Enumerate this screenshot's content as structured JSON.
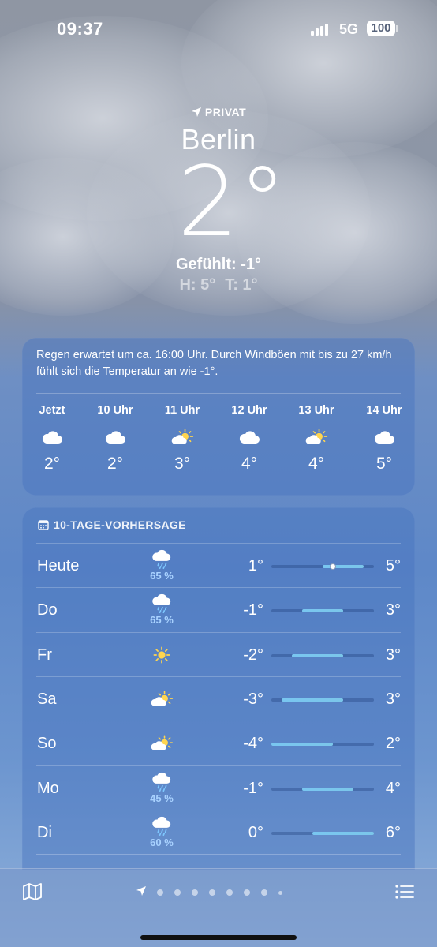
{
  "status_bar": {
    "time": "09:37",
    "network": "5G",
    "battery": "100"
  },
  "header": {
    "location_tag": "PRIVAT",
    "city": "Berlin",
    "temperature": "2°",
    "feels_like": "Gefühlt: -1°",
    "high": "H: 5°",
    "low": "T: 1°"
  },
  "hourly": {
    "summary": "Regen erwartet um ca. 16:00 Uhr. Durch Windböen mit bis zu 27 km/h fühlt sich die Temperatur an wie -1°.",
    "hours": [
      {
        "label": "Jetzt",
        "icon": "cloud-icon",
        "temp": "2°"
      },
      {
        "label": "10 Uhr",
        "icon": "cloud-icon",
        "temp": "2°"
      },
      {
        "label": "11 Uhr",
        "icon": "partly-sunny-icon",
        "temp": "3°"
      },
      {
        "label": "12 Uhr",
        "icon": "cloud-icon",
        "temp": "4°"
      },
      {
        "label": "13 Uhr",
        "icon": "partly-sunny-icon",
        "temp": "4°"
      },
      {
        "label": "14 Uhr",
        "icon": "cloud-icon",
        "temp": "5°"
      }
    ]
  },
  "forecast": {
    "title": "10-TAGE-VORHERSAGE",
    "range_min": -4,
    "range_max": 6,
    "days": [
      {
        "name": "Heute",
        "icon": "rain-cloud-icon",
        "precip": "65 %",
        "low": "1°",
        "high": "5°",
        "low_val": 1,
        "high_val": 5,
        "current_val": 2
      },
      {
        "name": "Do",
        "icon": "rain-cloud-icon",
        "precip": "65 %",
        "low": "-1°",
        "high": "3°",
        "low_val": -1,
        "high_val": 3
      },
      {
        "name": "Fr",
        "icon": "sun-icon",
        "precip": "",
        "low": "-2°",
        "high": "3°",
        "low_val": -2,
        "high_val": 3
      },
      {
        "name": "Sa",
        "icon": "partly-sunny-icon",
        "precip": "",
        "low": "-3°",
        "high": "3°",
        "low_val": -3,
        "high_val": 3
      },
      {
        "name": "So",
        "icon": "partly-sunny-icon",
        "precip": "",
        "low": "-4°",
        "high": "2°",
        "low_val": -4,
        "high_val": 2
      },
      {
        "name": "Mo",
        "icon": "rain-cloud-icon",
        "precip": "45 %",
        "low": "-1°",
        "high": "4°",
        "low_val": -1,
        "high_val": 4
      },
      {
        "name": "Di",
        "icon": "rain-cloud-icon",
        "precip": "60 %",
        "low": "0°",
        "high": "6°",
        "low_val": 0,
        "high_val": 6
      }
    ]
  },
  "toolbar": {
    "page_count": 9,
    "active_page": 0
  }
}
